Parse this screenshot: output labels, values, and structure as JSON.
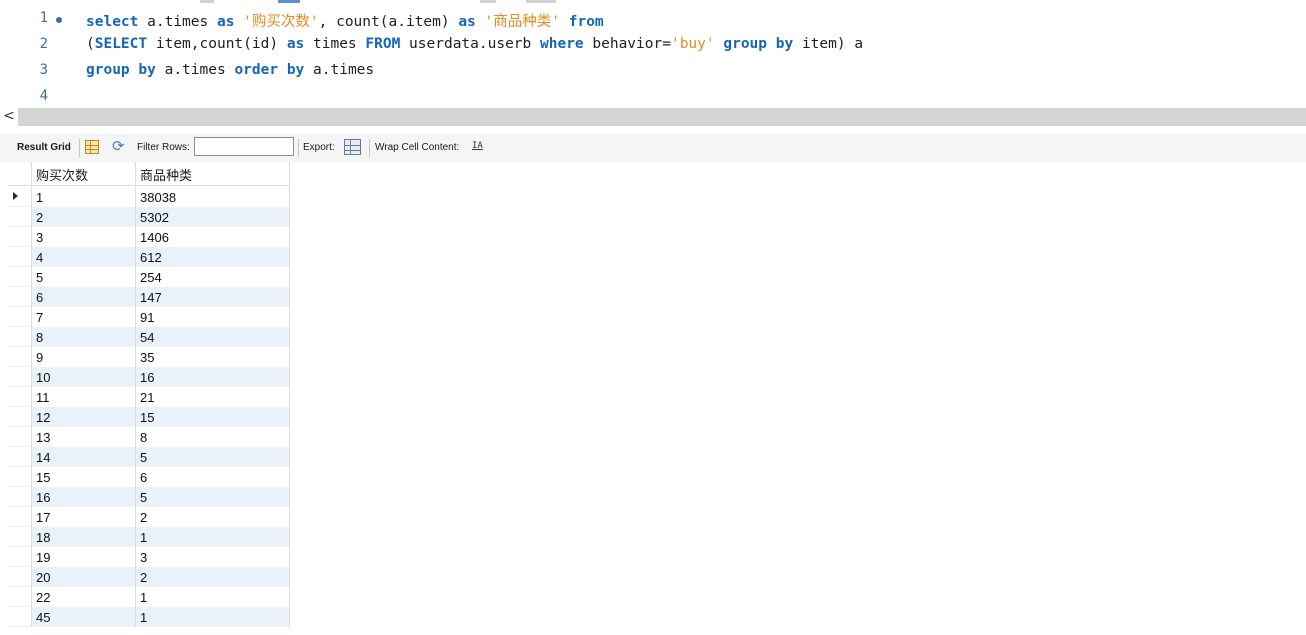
{
  "editor": {
    "lines": [
      {
        "number": "1",
        "tokens": [
          {
            "t": "select",
            "k": "kw"
          },
          {
            "t": " a.times ",
            "k": ""
          },
          {
            "t": "as",
            "k": "kw"
          },
          {
            "t": " ",
            "k": ""
          },
          {
            "t": "'购买次数'",
            "k": "str"
          },
          {
            "t": ", count(a.item) ",
            "k": ""
          },
          {
            "t": "as",
            "k": "kw"
          },
          {
            "t": " ",
            "k": ""
          },
          {
            "t": "'商品种类'",
            "k": "str"
          },
          {
            "t": " ",
            "k": ""
          },
          {
            "t": "from",
            "k": "kw"
          }
        ]
      },
      {
        "number": "2",
        "tokens": [
          {
            "t": "(",
            "k": ""
          },
          {
            "t": "SELECT",
            "k": "kw"
          },
          {
            "t": " item,count(id) ",
            "k": ""
          },
          {
            "t": "as",
            "k": "kw"
          },
          {
            "t": " times ",
            "k": ""
          },
          {
            "t": "FROM",
            "k": "kw"
          },
          {
            "t": " userdata.userb ",
            "k": ""
          },
          {
            "t": "where",
            "k": "kw"
          },
          {
            "t": " behavior=",
            "k": ""
          },
          {
            "t": "'buy'",
            "k": "str"
          },
          {
            "t": " ",
            "k": ""
          },
          {
            "t": "group",
            "k": "kw"
          },
          {
            "t": " ",
            "k": ""
          },
          {
            "t": "by",
            "k": "kw"
          },
          {
            "t": " item) a",
            "k": ""
          }
        ]
      },
      {
        "number": "3",
        "tokens": [
          {
            "t": "group",
            "k": "kw"
          },
          {
            "t": " ",
            "k": ""
          },
          {
            "t": "by",
            "k": "kw"
          },
          {
            "t": " a.times ",
            "k": ""
          },
          {
            "t": "order",
            "k": "kw"
          },
          {
            "t": " ",
            "k": ""
          },
          {
            "t": "by",
            "k": "kw"
          },
          {
            "t": " a.times",
            "k": ""
          }
        ]
      },
      {
        "number": "4",
        "tokens": []
      }
    ]
  },
  "scrollbar": {
    "left_arrow": "<"
  },
  "toolbar": {
    "result_grid": "Result Grid",
    "filter_rows": "Filter Rows:",
    "filter_value": "",
    "export": "Export:",
    "wrap_cell": "Wrap Cell Content:",
    "wrap_icon_text": "IA"
  },
  "grid": {
    "columns": [
      "购买次数",
      "商品种类"
    ],
    "rows": [
      [
        "1",
        "38038"
      ],
      [
        "2",
        "5302"
      ],
      [
        "3",
        "1406"
      ],
      [
        "4",
        "612"
      ],
      [
        "5",
        "254"
      ],
      [
        "6",
        "147"
      ],
      [
        "7",
        "91"
      ],
      [
        "8",
        "54"
      ],
      [
        "9",
        "35"
      ],
      [
        "10",
        "16"
      ],
      [
        "11",
        "21"
      ],
      [
        "12",
        "15"
      ],
      [
        "13",
        "8"
      ],
      [
        "14",
        "5"
      ],
      [
        "15",
        "6"
      ],
      [
        "16",
        "5"
      ],
      [
        "17",
        "2"
      ],
      [
        "18",
        "1"
      ],
      [
        "19",
        "3"
      ],
      [
        "20",
        "2"
      ],
      [
        "22",
        "1"
      ],
      [
        "45",
        "1"
      ]
    ]
  }
}
